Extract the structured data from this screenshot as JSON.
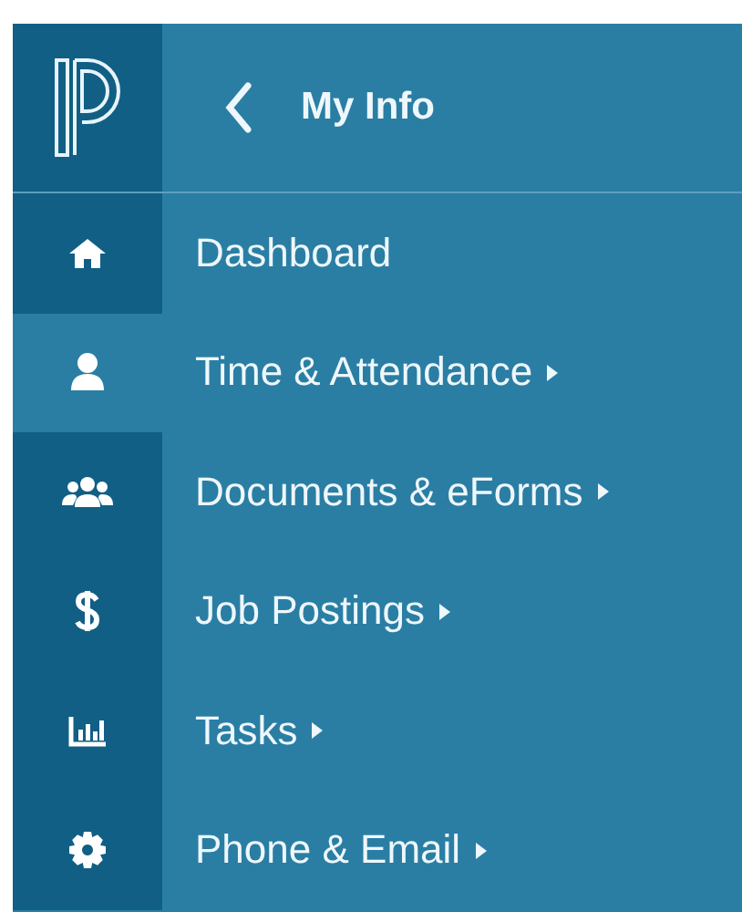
{
  "header": {
    "title": "My Info"
  },
  "menu": [
    {
      "kind": "home",
      "label": "Dashboard",
      "submenu": false,
      "selected": false
    },
    {
      "kind": "user",
      "label": "Time & Attendance",
      "submenu": true,
      "selected": true
    },
    {
      "kind": "group",
      "label": "Documents & eForms",
      "submenu": true,
      "selected": false
    },
    {
      "kind": "dollar",
      "label": "Job Postings",
      "submenu": true,
      "selected": false
    },
    {
      "kind": "chart",
      "label": "Tasks",
      "submenu": true,
      "selected": false
    },
    {
      "kind": "gear",
      "label": "Phone & Email",
      "submenu": true,
      "selected": false
    }
  ]
}
